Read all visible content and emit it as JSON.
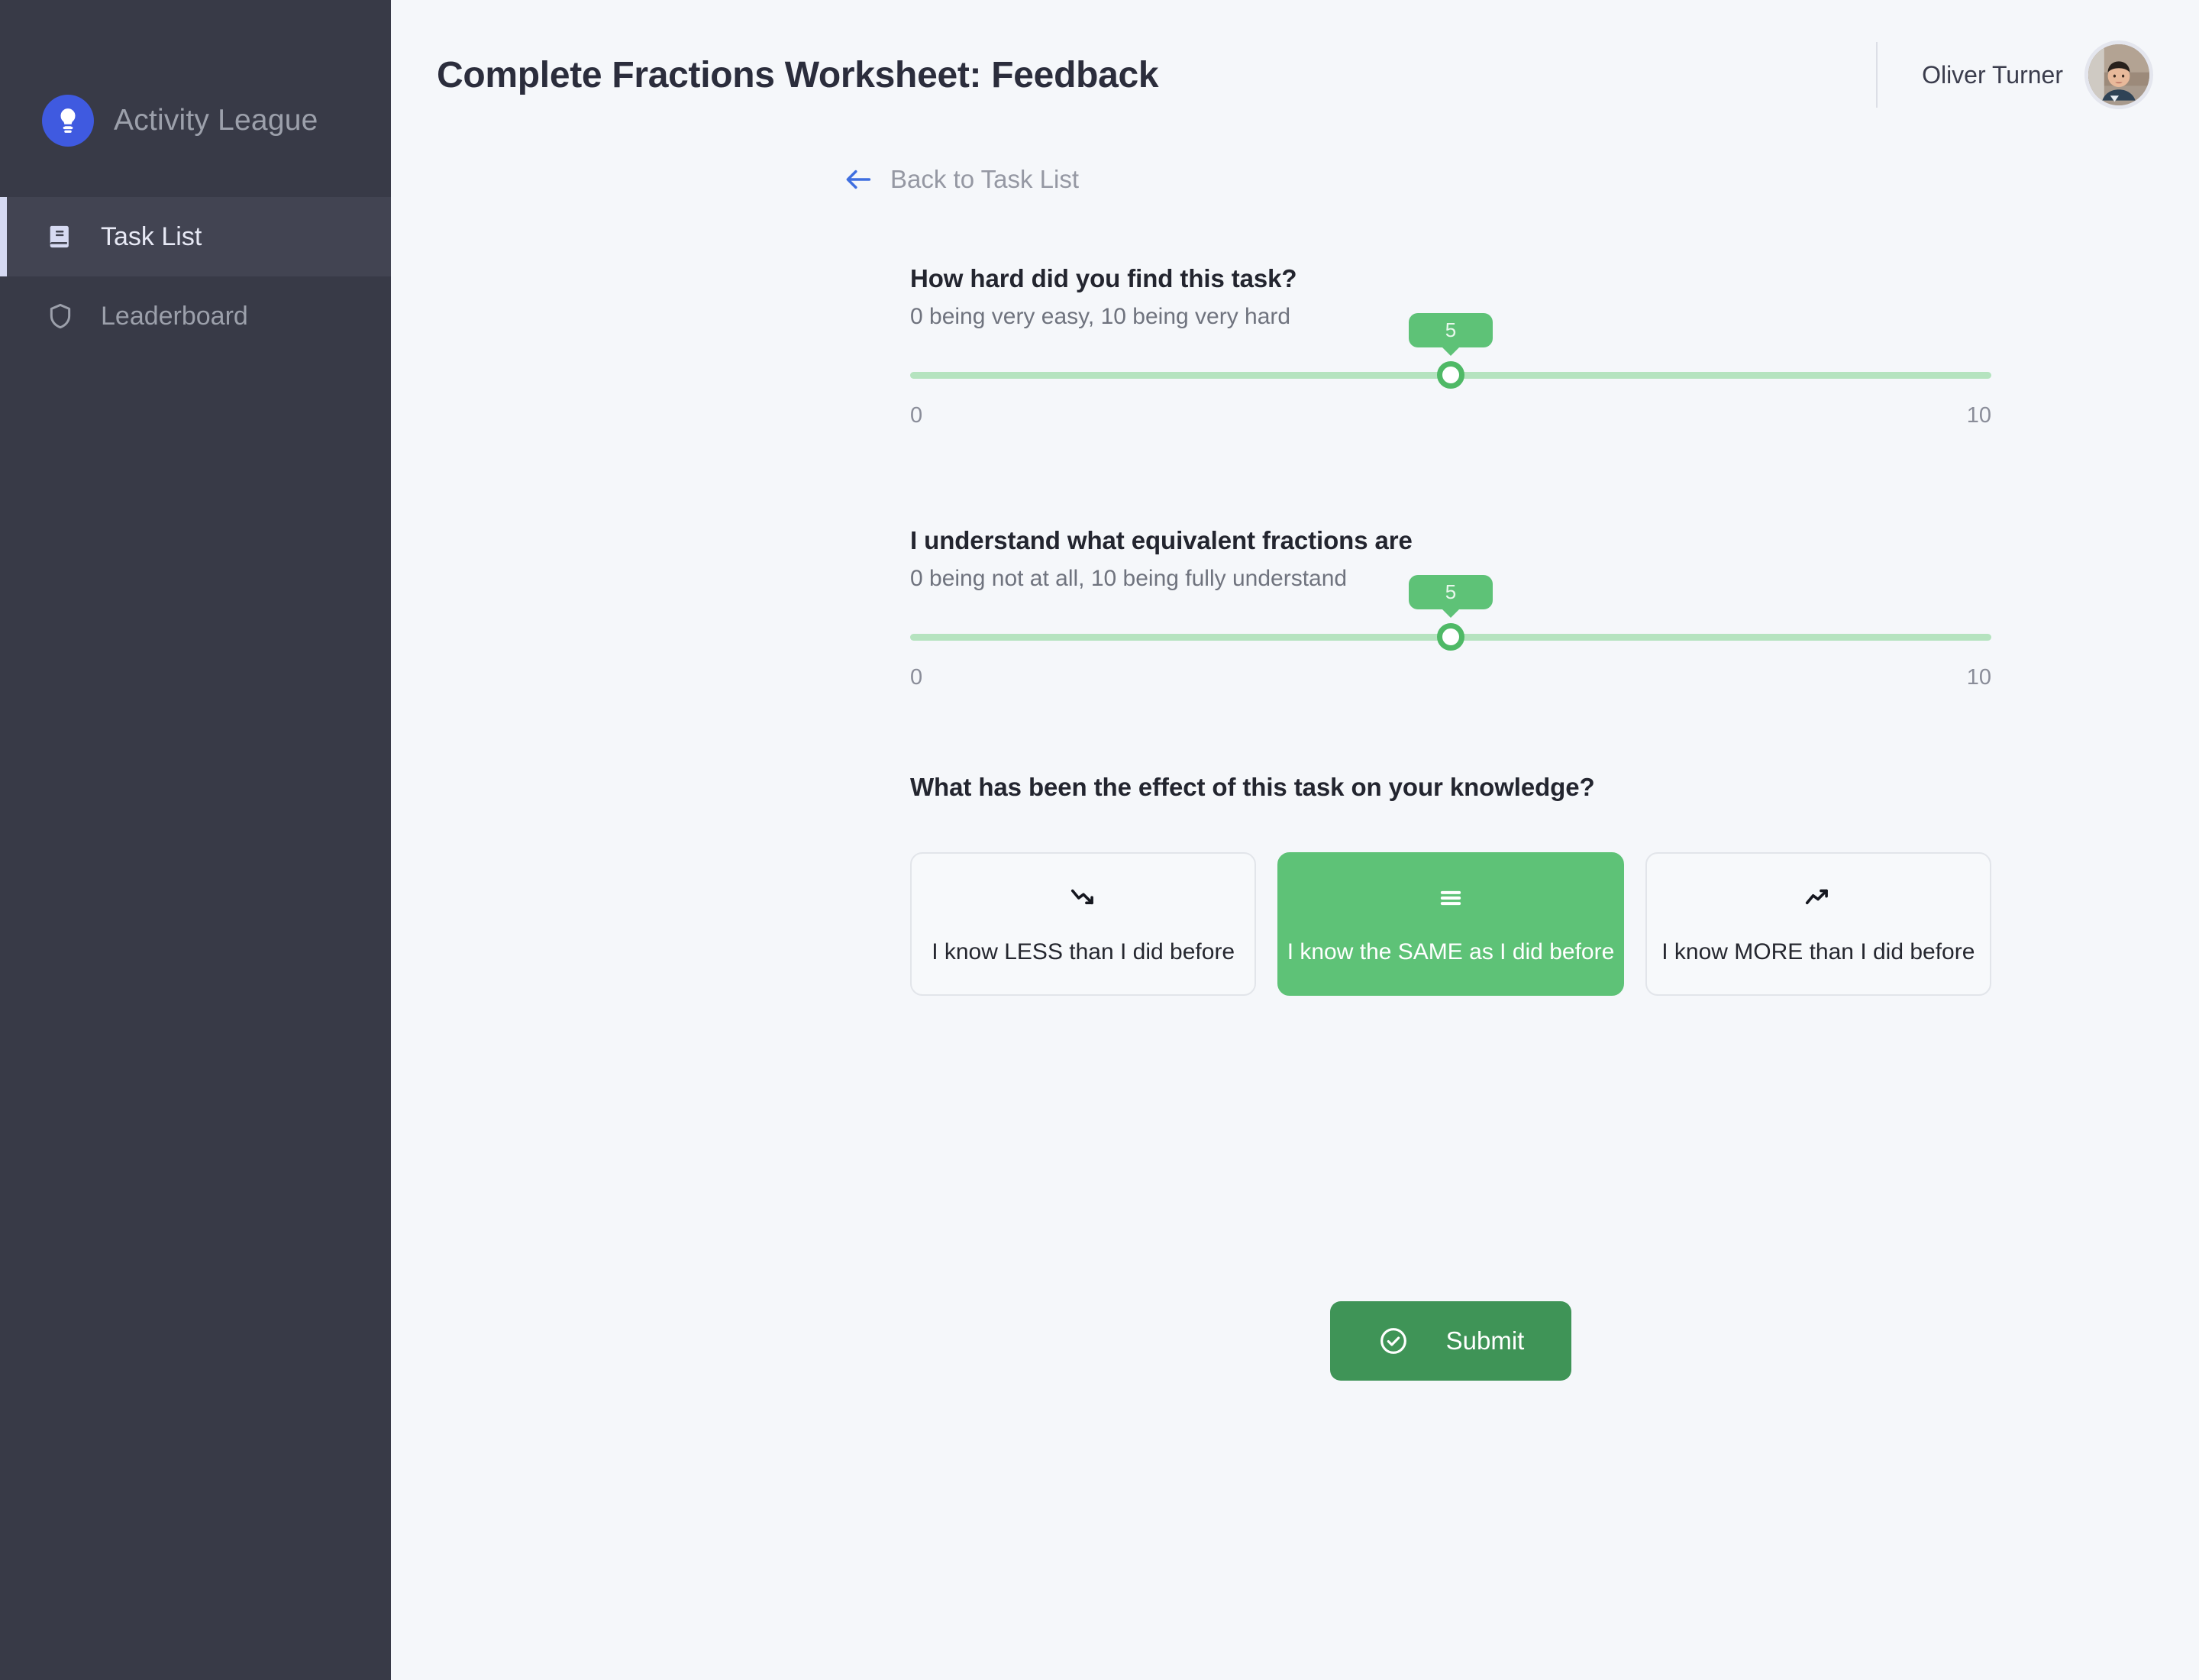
{
  "sidebar": {
    "brand": {
      "name": "Activity League",
      "logo_icon": "lightbulb-icon",
      "logo_color": "#3f5ae0"
    },
    "items": [
      {
        "label": "Task List",
        "icon": "book-icon",
        "active": true
      },
      {
        "label": "Leaderboard",
        "icon": "shield-icon",
        "active": false
      }
    ]
  },
  "header": {
    "title": "Complete Fractions Worksheet: Feedback",
    "user_name": "Oliver Turner",
    "avatar_icon": "user-avatar"
  },
  "back_link": {
    "label": "Back to Task List",
    "icon": "arrow-left-icon",
    "color": "#3f6fe0"
  },
  "questions": [
    {
      "title": "How hard did you find this task?",
      "subtitle": "0 being very easy, 10 being very hard",
      "value": "5",
      "min_label": "0",
      "max_label": "10",
      "min": 0,
      "max": 10,
      "track_color": "#b5e3bf",
      "accent_color": "#4fb966"
    },
    {
      "title": "I understand what equivalent fractions are",
      "subtitle": "0 being not at all, 10 being fully understand",
      "value": "5",
      "min_label": "0",
      "max_label": "10",
      "min": 0,
      "max": 10,
      "track_color": "#b5e3bf",
      "accent_color": "#4fb966"
    }
  ],
  "effect_question": {
    "title": "What has been the effect of this task on your knowledge?",
    "options": [
      {
        "label": "I know LESS than I did before",
        "icon": "trend-down-icon",
        "selected": false
      },
      {
        "label": "I know the SAME as I did before",
        "icon": "equals-lines-icon",
        "selected": true
      },
      {
        "label": "I know MORE than I did before",
        "icon": "trend-up-icon",
        "selected": false
      }
    ],
    "selected_color": "#5ec277"
  },
  "submit": {
    "label": "Submit",
    "icon": "check-circle-icon",
    "color": "#3f9457"
  }
}
